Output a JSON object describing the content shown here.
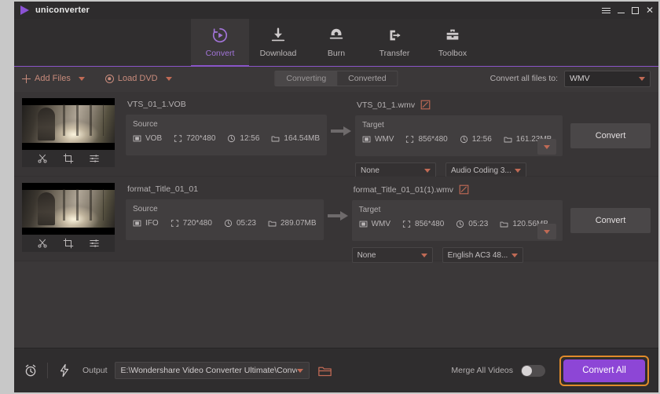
{
  "window": {
    "title": "uniconverter",
    "controls": {
      "menu": "menu-icon",
      "minimize": "–",
      "maximize": "□",
      "close": "✕"
    }
  },
  "nav": {
    "items": [
      {
        "label": "Convert",
        "icon": "convert-icon",
        "active": true
      },
      {
        "label": "Download",
        "icon": "download-icon",
        "active": false
      },
      {
        "label": "Burn",
        "icon": "burn-icon",
        "active": false
      },
      {
        "label": "Transfer",
        "icon": "transfer-icon",
        "active": false
      },
      {
        "label": "Toolbox",
        "icon": "toolbox-icon",
        "active": false
      }
    ]
  },
  "toolbar": {
    "add_files": "Add Files",
    "load_dvd": "Load DVD",
    "segments": [
      {
        "label": "Converting",
        "selected": true
      },
      {
        "label": "Converted",
        "selected": false
      }
    ],
    "convert_all_to_label": "Convert all files to:",
    "convert_all_to_value": "WMV"
  },
  "rows": [
    {
      "source_name": "VTS_01_1.VOB",
      "source": {
        "title": "Source",
        "format": "VOB",
        "resolution": "720*480",
        "duration": "12:56",
        "size": "164.54MB"
      },
      "target_name": "VTS_01_1.wmv",
      "target": {
        "title": "Target",
        "format": "WMV",
        "resolution": "856*480",
        "duration": "12:56",
        "size": "161.23MB"
      },
      "convert_label": "Convert",
      "subtitle_select": "None",
      "audio_select": "Audio Coding 3..."
    },
    {
      "source_name": "format_Title_01_01",
      "source": {
        "title": "Source",
        "format": "IFO",
        "resolution": "720*480",
        "duration": "05:23",
        "size": "289.07MB"
      },
      "target_name": "format_Title_01_01(1).wmv",
      "target": {
        "title": "Target",
        "format": "WMV",
        "resolution": "856*480",
        "duration": "05:23",
        "size": "120.56MB"
      },
      "convert_label": "Convert",
      "subtitle_select": "None",
      "audio_select": "English AC3 48..."
    }
  ],
  "bottom": {
    "output_label": "Output",
    "output_path": "E:\\Wondershare Video Converter Ultimate\\Converted",
    "merge_label": "Merge All Videos",
    "merge_on": false,
    "convert_all_label": "Convert All"
  },
  "colors": {
    "accent_purple": "#8d46d6",
    "nav_active": "#a274d8",
    "toolbar_coral": "#c88b7c",
    "caret_red": "#c06a55",
    "highlight_orange": "#e08a2a",
    "window_bg": "#3b3839",
    "panel_bg": "#413e3f",
    "bottom_bg": "#2f2d2e"
  }
}
